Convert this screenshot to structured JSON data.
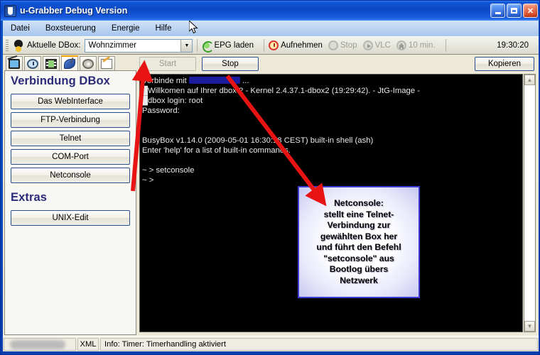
{
  "window": {
    "title": "u-Grabber Debug Version",
    "app_icon": "app-window-icon",
    "caption": {
      "minimize": "minimize-icon",
      "maximize": "maximize-icon",
      "close": "✕"
    }
  },
  "menubar": {
    "items": [
      {
        "label": "Datei"
      },
      {
        "label": "Boxsteuerung"
      },
      {
        "label": "Energie"
      },
      {
        "label": "Hilfe"
      }
    ]
  },
  "toolbar": {
    "dbox_label": "Aktuelle DBox:",
    "dbox_value": "Wohnzimmer",
    "dbox_arrow": "▼",
    "epg_label": "EPG laden",
    "record_label": "Aufnehmen",
    "stop_label": "Stop",
    "vlc_label": "VLC",
    "minutes_label": "10 min.",
    "clock": "19:30:20"
  },
  "sidebar": {
    "tabs": [
      {
        "name": "tv-tab",
        "icon": "tv-icon",
        "active": false
      },
      {
        "name": "timer-tab",
        "icon": "alarm-clock-icon",
        "active": false
      },
      {
        "name": "film-tab",
        "icon": "film-strip-icon",
        "active": false
      },
      {
        "name": "connection-tab",
        "icon": "satellite-dish-icon",
        "active": true
      },
      {
        "name": "settings-tab",
        "icon": "gear-icon",
        "active": false
      },
      {
        "name": "edit-tab",
        "icon": "pencil-icon",
        "active": false
      }
    ],
    "section_connection": "Verbindung DBox",
    "buttons_connection": [
      {
        "label": "Das WebInterface"
      },
      {
        "label": "FTP-Verbindung"
      },
      {
        "label": "Telnet"
      },
      {
        "label": "COM-Port"
      },
      {
        "label": "Netconsole"
      }
    ],
    "section_extras": "Extras",
    "buttons_extras": [
      {
        "label": "UNIX-Edit"
      }
    ]
  },
  "controls": {
    "start_label": "Start",
    "stop_label": "Stop",
    "copy_label": "Kopieren"
  },
  "terminal": {
    "line_1_prefix": "Verbinde mit ",
    "line_1_suffix": " ...",
    "body": "█Willkomen auf Ihrer dbox 2 - Kernel 2.4.37.1-dbox2 (19:29:42). - JtG-Image -\n█dbox login: root\nPassword:\n\n\nBusyBox v1.14.0 (2009-05-01 16:30:18 CEST) built-in shell (ash)\nEnter 'help' for a list of built-in commands.\n\n~ > setconsole\n~ >",
    "scroll_up": "▲",
    "scroll_down": "▼"
  },
  "callout": {
    "text": "Netconsole:\nstellt eine Telnet-\nVerbindung zur\ngewählten Box her\nund führt den Befehl\n\"setconsole\" aus\nBootlog übers\nNetzwerk",
    "border_color": "#3b3bd2"
  },
  "annotations": {
    "arrow_color": "#e81414",
    "arrow_1": "netconsole-button-to-start-button",
    "arrow_2": "terminal-to-callout"
  },
  "statusbar": {
    "cell_1": "",
    "cell_2": "XML",
    "cell_3": "Info: Timer: Timerhandling aktiviert"
  }
}
